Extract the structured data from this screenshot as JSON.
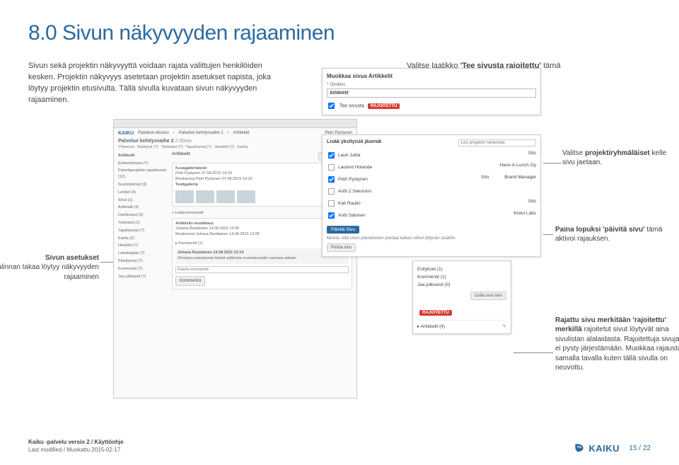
{
  "heading": "8.0 Sivun näkyvyyden rajaaminen",
  "intro": "Sivun sekä projektin näkyvyyttä voidaan rajata valittujen henkilöiden kesken. Projektin näkyvyys asetetaan projektin asetukset napista, joka löytyy projektin etusivulta. Tällä sivulla kuvataan sivun näkyvyyden rajaaminen.",
  "callout_top_right": {
    "pre": "Valitse laatikko ",
    "b": "'Tee sivusta rajoitettu'",
    "post": " tämä aukaisee henkilövalintalaatikon."
  },
  "main_shot": {
    "logo": "KAIKU",
    "breadcrumb": [
      "Palvelun etusivu",
      "Palvelun kehitysvaihe 2",
      "Artikkelit"
    ],
    "user": "Petri Pystynen",
    "title": "Palvelun kehitysvaihe 2",
    "version": "2.0beta",
    "tabs": [
      "Yhteensä",
      "Etsittynä (?)",
      "Tiedostot (?)",
      "Tapahtumat (?)",
      "Henkilöt (?)",
      "Kartta"
    ],
    "sidebar": {
      "heading": "Artikkelit",
      "items": [
        "Esimerkkiasia (?)",
        "Palveluprojektin tapahtumat (12)",
        "Suunnitelmat (3)",
        "Lehdet (4)",
        "Sivut (1)",
        "Artikkelit (4)",
        "Dashboard (3)",
        "Tiedostot (2)",
        "Tapahtumat (?)",
        "Kartta (2)",
        "Henkilöt (?)",
        "Leikekirjattu (?)",
        "Päivitykset (?)",
        "Kommentit (?)",
        "Jaa julkisesti (?)"
      ]
    },
    "content": {
      "header": "Artikkelit",
      "add_btn": "Lisää artikkeli",
      "card1": {
        "title": "Kuvagalleriatesti",
        "byline": "Petri Pystynen 07.08.2015 14:19",
        "mod": "Muokannut Petri Pystynen 07.08.2015 14:19",
        "sub": "Testigalleria"
      },
      "card2": {
        "title": "Artikkelin muokkaus",
        "byline": "Juhana Rautiainen 14.08.2015 13:05",
        "mod": "Muokannut Juhana Rautiainen 14.08.2015 13:05"
      },
      "comment_btn": "+ Lisää kommentti",
      "comments": "Kommentit (1)",
      "comment": {
        "author": "Juhana Rautiainen 14.08.2015 13:14",
        "text": "Onnistuu samaisesta tekstit artikkelia muokatessakin samaan aikaan."
      },
      "write_placeholder": "Kirjoita kommentti",
      "send": "Kommentoi"
    }
  },
  "overlay_edit": {
    "title": "Muokkaa sivua Artikkelit",
    "label_otsikko": "* Otsikko",
    "value_otsikko": "Artikkelit",
    "cb_label": "Tee sivusta",
    "badge": "RAJOITETTU"
  },
  "overlay_members": {
    "heading": "Lisää yksityisiä jäseniä",
    "search_placeholder": "Etsi projektin henkilöitä",
    "rows": [
      {
        "checked": true,
        "name": "Lauri Jutila",
        "role": "Sito"
      },
      {
        "checked": false,
        "name": "Laurent Holande",
        "role": "Have-A-Lunch Oy"
      },
      {
        "checked": true,
        "name": "Petri Pystynen",
        "role": "Sito",
        "extra": "Brand Manager"
      },
      {
        "checked": false,
        "name": "Antti 2 Sekonimi",
        "role": ""
      },
      {
        "checked": false,
        "name": "Kati Rautio",
        "role": "Sito"
      },
      {
        "checked": true,
        "name": "Antti Salonen",
        "role": "Kisko Labs"
      }
    ],
    "save": "Päivitä Sivu",
    "note": "Muista, että sivun poistaminen poistaa kaiken siihen liittyvän sisällön.",
    "delete": "Poista sivu"
  },
  "overlay_publish": {
    "rows": [
      {
        "label": "Esitykset (1)"
      },
      {
        "label": "Kommentit (1)"
      },
      {
        "label": "Jaa julkisesti (0)"
      }
    ],
    "add_btn": "Lisää uusi sivu",
    "badge": "RAJOITETTU",
    "art": "Artikkelit (4)"
  },
  "annotations": {
    "left": {
      "b": "Sivun asetukset",
      "post": " valinnan takaa löytyy näkyvyyden rajaaminen"
    },
    "members": {
      "pre": "Valitse ",
      "b": "projektiryhmäläiset",
      "post": " kelle sivu jaetaan."
    },
    "paivita": {
      "b": "Paina lopuksi 'päivitä sivu'",
      "post": " tämä aktivoi rajauksen."
    },
    "rajattu": {
      "b": "Rajattu sivu merkitään 'rajoitettu' merkillä",
      "post": " rajoitetut sivut löytyvät aina sivulistan alalaidasta. Rajoitettuja sivuja ei pysty järjestämään. Muokkaa rajausta samalla tavalla kuten tällä sivulla on neuvottu."
    }
  },
  "footer": {
    "product": "Kaiku -palvelu versio 2 / Käyttöohje",
    "modified": "Last modified / Muokattu 2015-02-17",
    "brand": "KAIKU",
    "page": "15 / 22"
  }
}
